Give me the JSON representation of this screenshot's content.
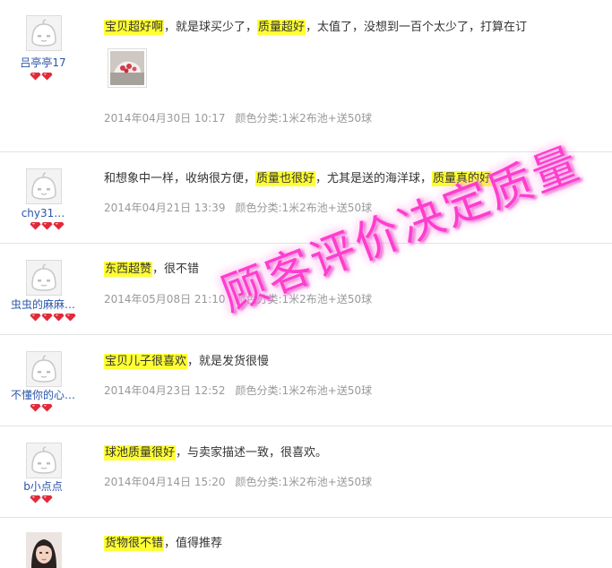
{
  "reviews": [
    {
      "user": "吕亭亭17",
      "gems": 2,
      "segments": [
        {
          "text": "宝贝超好啊",
          "hl": true
        },
        {
          "text": "，就是球买少了，",
          "hl": false
        },
        {
          "text": "质量超好",
          "hl": true
        },
        {
          "text": "，太值了，没想到一百个太少了，打算在订",
          "hl": false
        }
      ],
      "has_photo": true,
      "date": "2014年04月30日 10:17",
      "spec": "颜色分类:1米2布池+送50球"
    },
    {
      "user": "chy31…",
      "gems": 3,
      "segments": [
        {
          "text": "和想象中一样，收纳很方便，",
          "hl": false
        },
        {
          "text": "质量也很好",
          "hl": true
        },
        {
          "text": "，尤其是送的海洋球，",
          "hl": false
        },
        {
          "text": "质量真的好",
          "hl": true
        }
      ],
      "has_photo": false,
      "date": "2014年04月21日 13:39",
      "spec": "颜色分类:1米2布池+送50球"
    },
    {
      "user": "虫虫的麻麻…",
      "gems": 4,
      "segments": [
        {
          "text": "东西超赞",
          "hl": true
        },
        {
          "text": "，很不错",
          "hl": false
        }
      ],
      "has_photo": false,
      "date": "2014年05月08日 21:10",
      "spec": "颜色分类:1米2布池+送50球"
    },
    {
      "user": "不懂你的心…",
      "gems": 2,
      "segments": [
        {
          "text": "宝贝儿子很喜欢",
          "hl": true
        },
        {
          "text": "，就是发货很慢",
          "hl": false
        }
      ],
      "has_photo": false,
      "date": "2014年04月23日 12:52",
      "spec": "颜色分类:1米2布池+送50球"
    },
    {
      "user": "b小点点",
      "gems": 2,
      "segments": [
        {
          "text": "球池质量很好",
          "hl": true
        },
        {
          "text": "，与卖家描述一致，很喜欢。",
          "hl": false
        }
      ],
      "has_photo": false,
      "date": "2014年04月14日 15:20",
      "spec": "颜色分类:1米2布池+送50球"
    },
    {
      "user": "",
      "gems": 0,
      "segments": [
        {
          "text": "货物很不错",
          "hl": true
        },
        {
          "text": "，值得推荐",
          "hl": false
        }
      ],
      "has_photo": false,
      "date": "",
      "spec": ""
    }
  ],
  "watermark": "顾客评价决定质量",
  "colors": {
    "highlight": "#ffff33",
    "username": "#2a55a8",
    "meta": "#999999",
    "watermark": "#ff33cc",
    "gem": "#e02a3a"
  }
}
